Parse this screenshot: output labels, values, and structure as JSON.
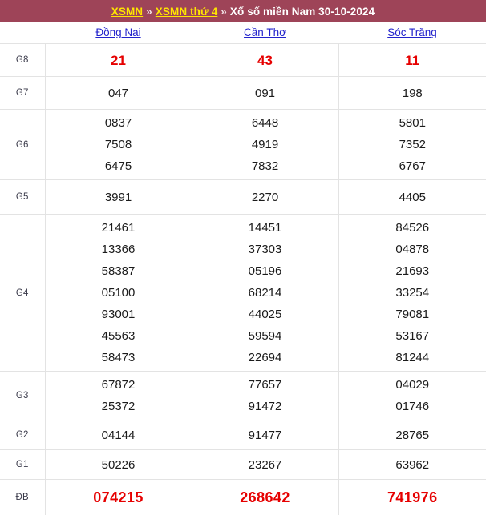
{
  "header": {
    "crumb_link_1": "XSMN",
    "separator": "»",
    "crumb_link_2": "XSMN thứ 4",
    "title": "Xổ số miền Nam 30-10-2024"
  },
  "table": {
    "label_column_header": "",
    "provinces": [
      "Đồng Nai",
      "Cần Thơ",
      "Sóc Trăng"
    ],
    "rows": [
      {
        "label": "G8",
        "values": [
          [
            "21"
          ],
          [
            "43"
          ],
          [
            "11"
          ]
        ]
      },
      {
        "label": "G7",
        "values": [
          [
            "047"
          ],
          [
            "091"
          ],
          [
            "198"
          ]
        ]
      },
      {
        "label": "G6",
        "values": [
          [
            "0837",
            "7508",
            "6475"
          ],
          [
            "6448",
            "4919",
            "7832"
          ],
          [
            "5801",
            "7352",
            "6767"
          ]
        ]
      },
      {
        "label": "G5",
        "values": [
          [
            "3991"
          ],
          [
            "2270"
          ],
          [
            "4405"
          ]
        ]
      },
      {
        "label": "G4",
        "values": [
          [
            "21461",
            "13366",
            "58387",
            "05100",
            "93001",
            "45563",
            "58473"
          ],
          [
            "14451",
            "37303",
            "05196",
            "68214",
            "44025",
            "59594",
            "22694"
          ],
          [
            "84526",
            "04878",
            "21693",
            "33254",
            "79081",
            "53167",
            "81244"
          ]
        ]
      },
      {
        "label": "G3",
        "values": [
          [
            "67872",
            "25372"
          ],
          [
            "77657",
            "91472"
          ],
          [
            "04029",
            "01746"
          ]
        ]
      },
      {
        "label": "G2",
        "values": [
          [
            "04144"
          ],
          [
            "91477"
          ],
          [
            "28765"
          ]
        ]
      },
      {
        "label": "G1",
        "values": [
          [
            "50226"
          ],
          [
            "23267"
          ],
          [
            "63962"
          ]
        ]
      },
      {
        "label": "ĐB",
        "values": [
          [
            "074215"
          ],
          [
            "268642"
          ],
          [
            "741976"
          ]
        ]
      }
    ]
  },
  "colors": {
    "header_bg": "#9e4458",
    "header_link": "#ffe600",
    "province_link": "#2222cc",
    "highlight_number": "#e60000",
    "number": "#1b1b1b",
    "border": "#e3e3e3"
  }
}
